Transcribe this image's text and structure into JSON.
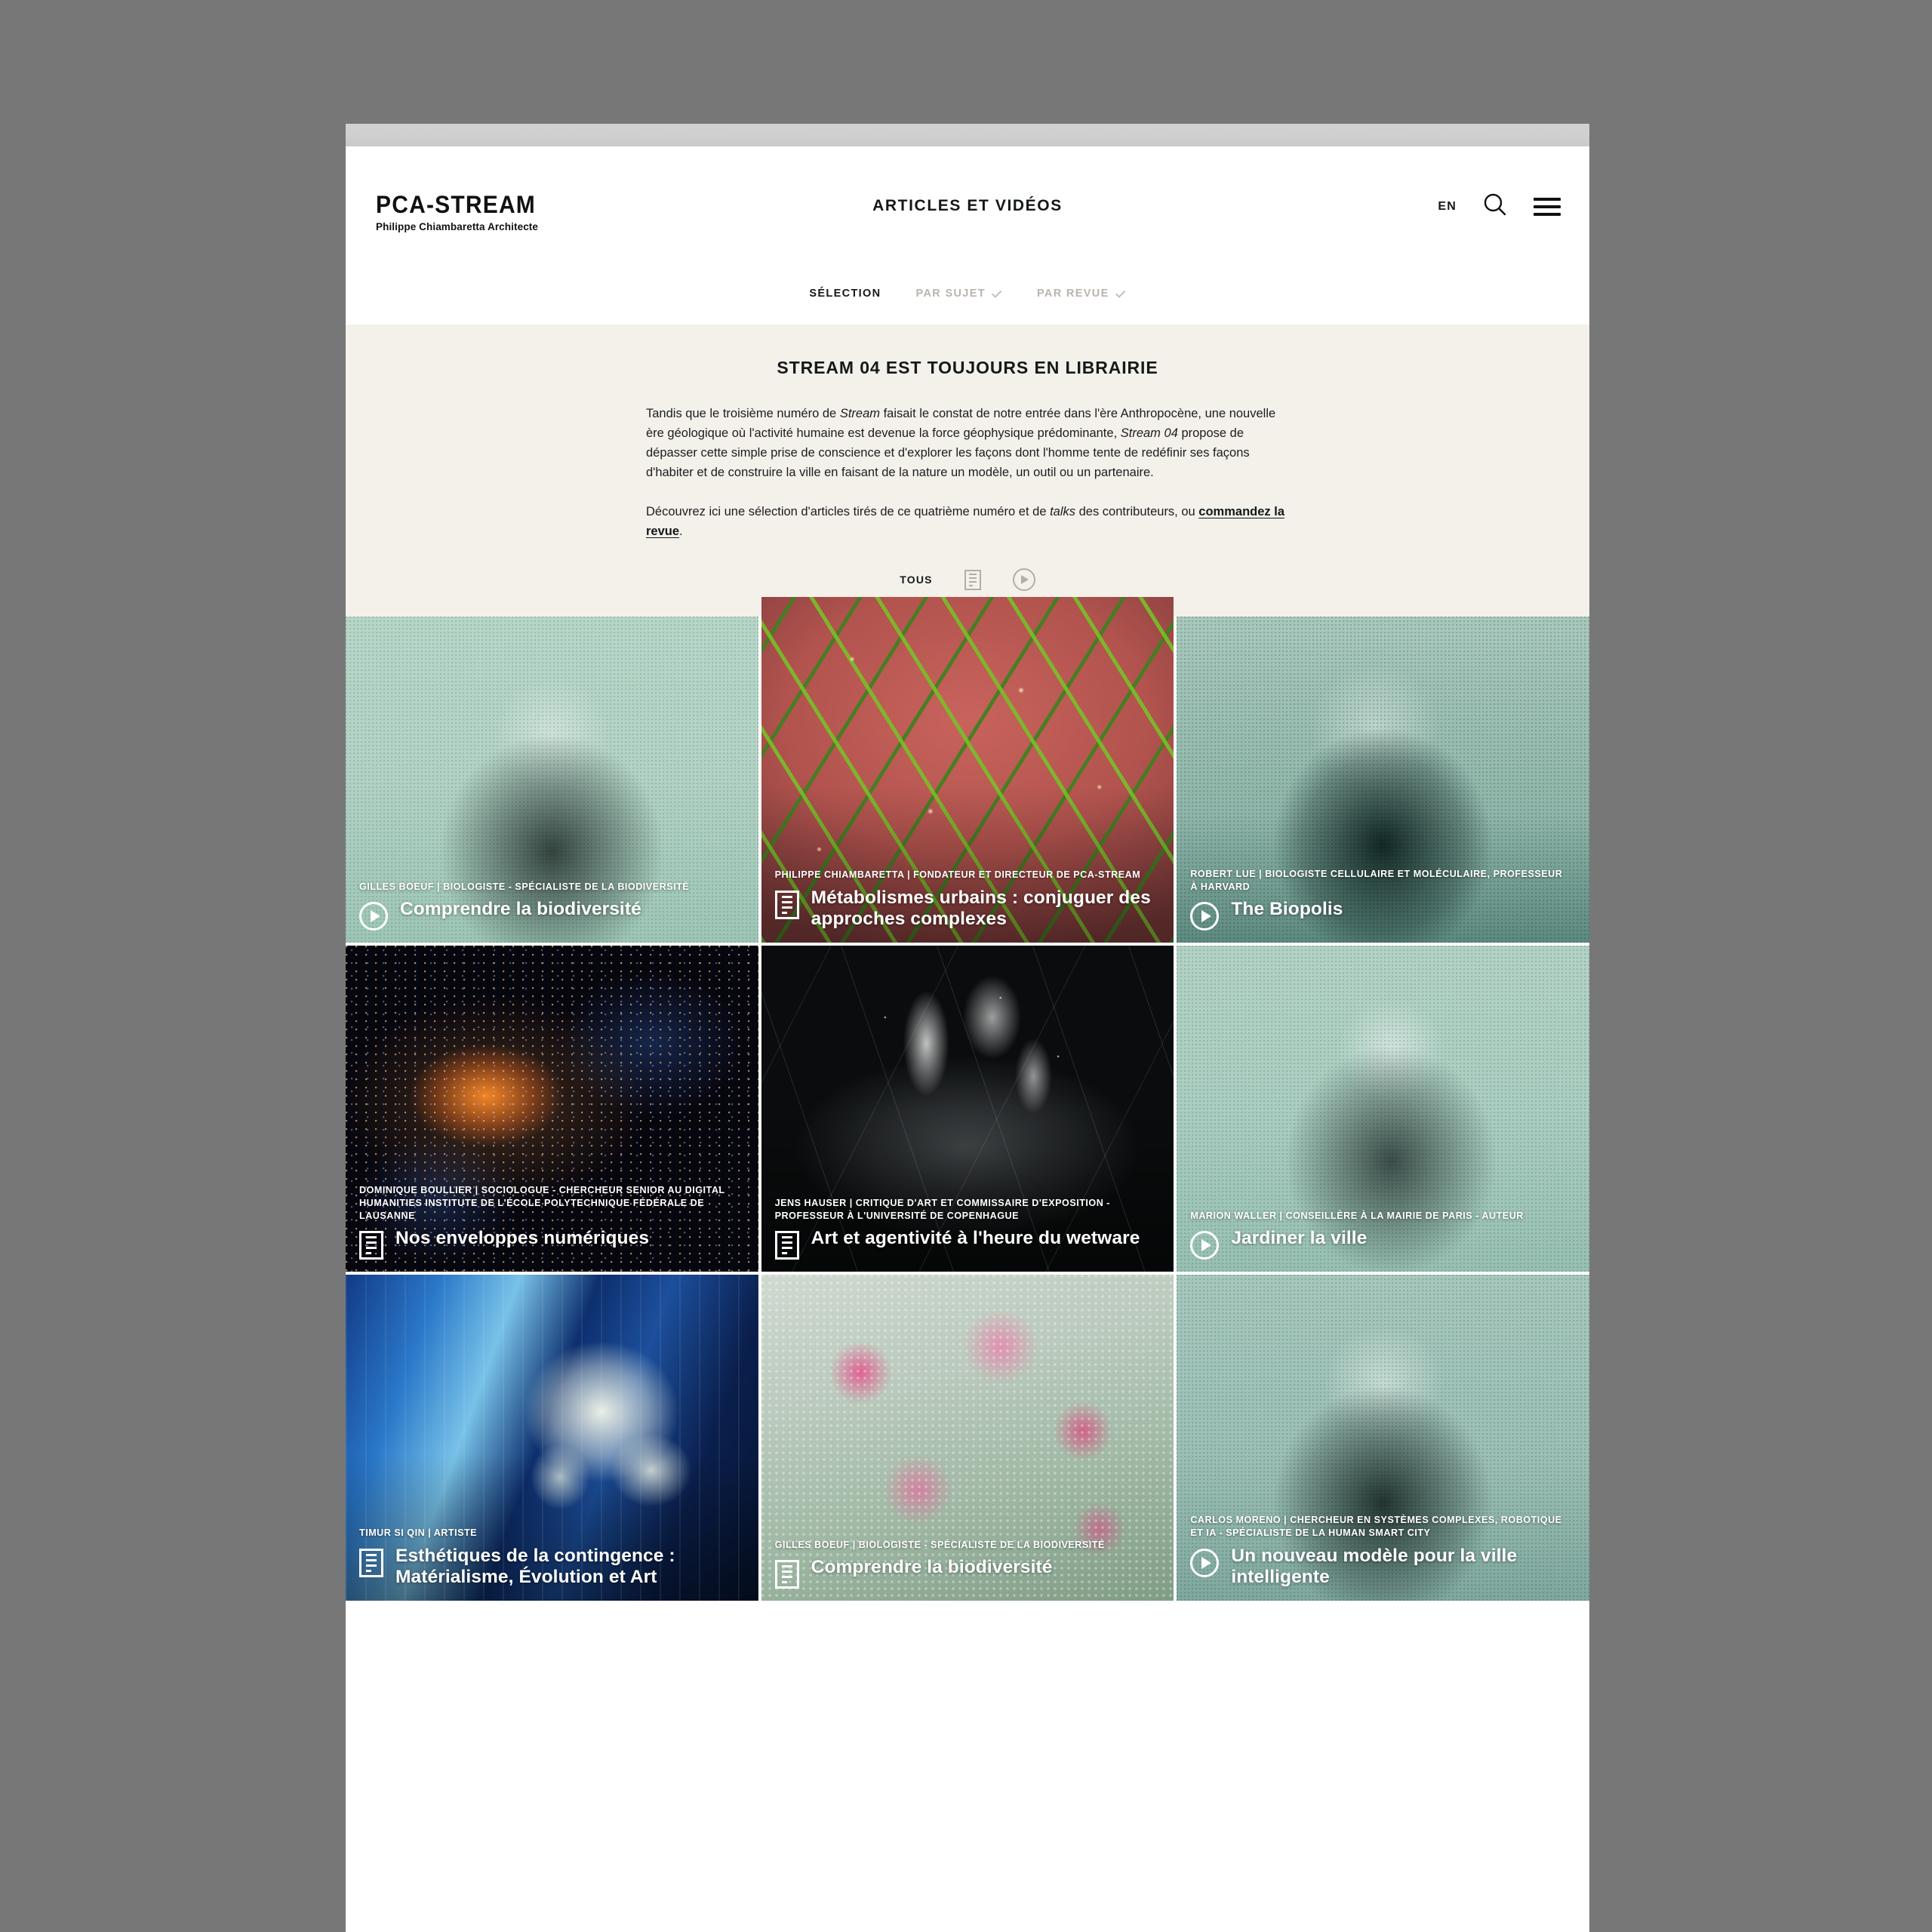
{
  "header": {
    "logo_word": "PCA-STREAM",
    "logo_sub": "Philippe Chiambaretta Architecte",
    "title": "ARTICLES ET VIDÉOS",
    "lang": "EN",
    "search_icon": "search-icon",
    "menu_icon": "hamburger-menu-icon"
  },
  "subnav": {
    "items": [
      {
        "label": "SÉLECTION",
        "has_chevron": false,
        "active": true
      },
      {
        "label": "PAR SUJET",
        "has_chevron": true,
        "active": false
      },
      {
        "label": "PAR REVUE",
        "has_chevron": true,
        "active": false
      }
    ]
  },
  "intro": {
    "title": "STREAM 04 EST TOUJOURS EN LIBRAIRIE",
    "p1_a": "Tandis que le troisième numéro de ",
    "p1_em1": "Stream",
    "p1_b": " faisait le constat de notre entrée dans l'ère Anthropocène, une nouvelle ère géologique où l'activité humaine est devenue la force géophysique prédominante, ",
    "p1_em2": "Stream 04",
    "p1_c": " propose de dépasser cette simple prise de conscience et d'explorer les façons dont l'homme tente de redéfinir ses façons d'habiter et de construire la ville en faisant de la nature un modèle, un outil ou un partenaire.",
    "p2_a": "Découvrez ici une sélection d'articles tirés de ce quatrième numéro et de ",
    "p2_em": "talks",
    "p2_b": " des contributeurs, ou ",
    "p2_link": "commandez la revue",
    "p2_c": "."
  },
  "filters": {
    "all_label": "TOUS",
    "doc_icon": "document-filter-icon",
    "video_icon": "play-circle-filter-icon"
  },
  "colors": {
    "page_background": "#ffffff",
    "intro_background": "#f4f1ea",
    "desktop_background": "#777777",
    "text_primary": "#14181a",
    "subnav_inactive": "#b9b4ae",
    "card_mint": "#b3d3c6"
  },
  "cards": [
    {
      "kicker": "GILLES BOEUF | BIOLOGISTE - SPÉCIALISTE DE LA BIODIVERSITÉ",
      "title": "Comprendre la biodiversité",
      "media": "video",
      "art": "art-portrait-green",
      "tall": false
    },
    {
      "kicker": "PHILIPPE CHIAMBARETTA | FONDATEUR ET DIRECTEUR DE PCA-STREAM",
      "title": "Métabolismes urbains : conjuguer des approches complexes",
      "media": "article",
      "art": "art-lattice",
      "tall": true
    },
    {
      "kicker": "ROBERT LUE | BIOLOGISTE CELLULAIRE ET MOLÉCULAIRE, PROFESSEUR À HARVARD",
      "title": "The Biopolis",
      "media": "video",
      "art": "art-portrait-dark",
      "tall": false
    },
    {
      "kicker": "DOMINIQUE BOULLIER | SOCIOLOGUE - CHERCHEUR SENIOR AU DIGITAL HUMANITIES INSTITUTE DE L'ÉCOLE POLYTECHNIQUE FÉDÉRALE DE LAUSANNE",
      "title": "Nos enveloppes numériques",
      "media": "article",
      "art": "art-starfield",
      "tall": false
    },
    {
      "kicker": "JENS HAUSER | CRITIQUE D'ART ET COMMISSAIRE D'EXPOSITION - PROFESSEUR À L'UNIVERSITÉ DE COPENHAGUE",
      "title": "Art et agentivité à l'heure du wetware",
      "media": "article",
      "art": "art-xray",
      "tall": false
    },
    {
      "kicker": "MARION WALLER | CONSEILLÈRE À LA MAIRIE DE PARIS - AUTEUR",
      "title": "Jardiner la ville",
      "media": "video",
      "art": "art-portrait-grey",
      "tall": false
    },
    {
      "kicker": "TIMUR SI QIN | ARTISTE",
      "title": "Esthétiques de la contingence : Matérialisme, Évolution et Art",
      "media": "article",
      "art": "art-ice",
      "tall": false
    },
    {
      "kicker": "GILLES BOEUF | BIOLOGISTE - SPÉCIALISTE DE LA BIODIVERSITÉ",
      "title": "Comprendre la biodiversité",
      "media": "article",
      "art": "art-moss",
      "tall": false
    },
    {
      "kicker": "CARLOS MORENO | CHERCHEUR EN SYSTÈMES COMPLEXES, ROBOTIQUE ET IA - SPÉCIALISTE DE LA HUMAN SMART CITY",
      "title": "Un nouveau modèle pour la ville intelligente",
      "media": "video",
      "art": "art-portrait-teal",
      "tall": false
    }
  ]
}
